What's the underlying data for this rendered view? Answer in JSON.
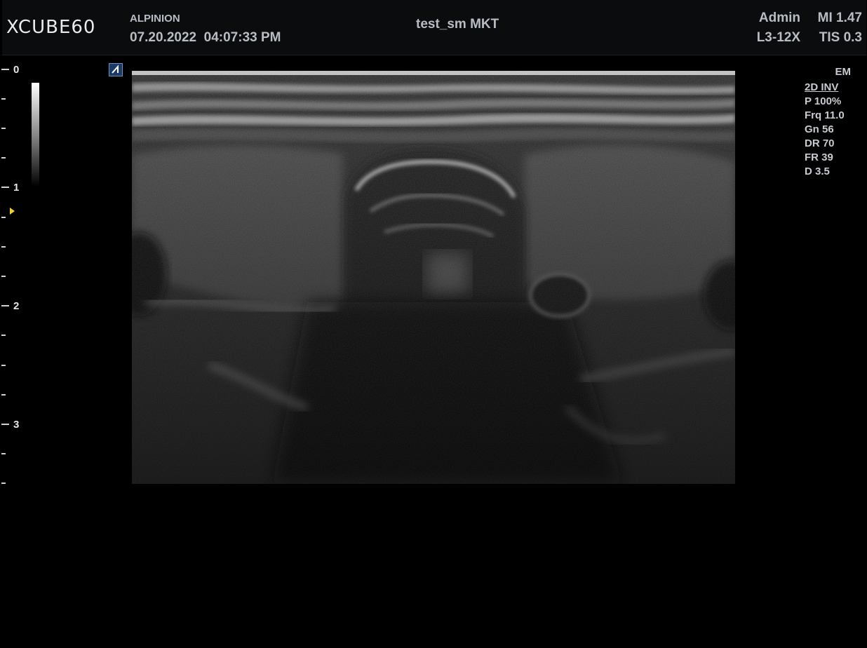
{
  "header": {
    "logo": "XCUBE60",
    "manufacturer": "ALPINION",
    "date": "07.20.2022",
    "time": "04:07:33 PM",
    "patient": "test_sm MKT",
    "user": "Admin",
    "probe": "L3-12X",
    "mi": "MI 1.47",
    "tis": "TIS 0.3"
  },
  "depth_scale": {
    "labels": [
      "0",
      "1",
      "2",
      "3"
    ]
  },
  "params": {
    "em": "EM",
    "mode": "2D INV",
    "power": "P 100%",
    "frequency": "Frq 11.0",
    "gain": "Gn 56",
    "dynamic_range": "DR 70",
    "frame_rate": "FR 39",
    "depth": "D 3.5"
  },
  "colors": {
    "focus_marker": "#f0d030",
    "orientation_marker": "#1c3a66"
  }
}
